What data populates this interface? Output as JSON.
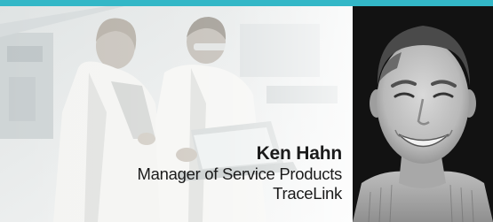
{
  "banner": {
    "accent_color": "#33b7c7",
    "speaker": {
      "name": "Ken Hahn",
      "title": "Manager of Service Products",
      "company": "TraceLink"
    },
    "background_image": "two-workers-lab-coats-with-laptop",
    "portrait_image": "speaker-headshot-grayscale"
  }
}
